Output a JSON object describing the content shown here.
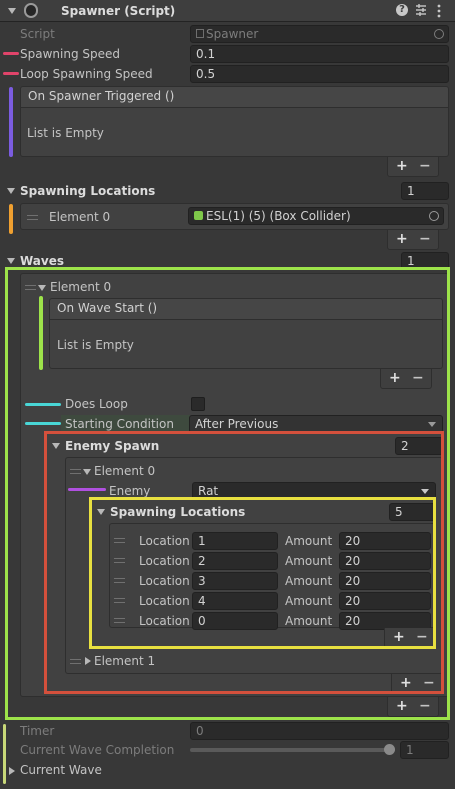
{
  "component": {
    "title": "Spawner (Script)",
    "icons": [
      "script-icon",
      "help-icon",
      "preset-icon",
      "more-menu-icon"
    ]
  },
  "fields": {
    "script_label": "Script",
    "script_value": "Spawner",
    "spawning_speed_label": "Spawning Speed",
    "spawning_speed_value": "0.1",
    "loop_speed_label": "Loop Spawning Speed",
    "loop_speed_value": "0.5"
  },
  "event_on_spawner_triggered": {
    "title": "On Spawner Triggered ()",
    "empty": "List is Empty"
  },
  "spawning_locations": {
    "label": "Spawning Locations",
    "count": "1",
    "element_label": "Element 0",
    "element_value": "ESL(1) (5) (Box Collider)"
  },
  "waves": {
    "label": "Waves",
    "count": "1",
    "element0": {
      "label": "Element 0",
      "on_wave_start": {
        "title": "On Wave Start ()",
        "empty": "List is Empty"
      },
      "does_loop_label": "Does Loop",
      "starting_condition_label": "Starting Condition",
      "starting_condition_value": "After Previous",
      "enemy_spawn": {
        "label": "Enemy Spawn",
        "count": "2",
        "element0_label": "Element 0",
        "enemy_label": "Enemy",
        "enemy_value": "Rat",
        "spawning_locations": {
          "label": "Spawning Locations",
          "count": "5",
          "location_label": "Location",
          "amount_label": "Amount",
          "rows": [
            {
              "location": "1",
              "amount": "20"
            },
            {
              "location": "2",
              "amount": "20"
            },
            {
              "location": "3",
              "amount": "20"
            },
            {
              "location": "4",
              "amount": "20"
            },
            {
              "location": "0",
              "amount": "20"
            }
          ]
        },
        "element1_label": "Element 1"
      }
    }
  },
  "timer": {
    "label": "Timer",
    "value": "0"
  },
  "completion": {
    "label": "Current Wave Completion",
    "value": "1",
    "fraction": 1.0
  },
  "current_wave": {
    "label": "Current Wave"
  },
  "buttons": {
    "plus": "+",
    "minus": "−"
  },
  "colors": {
    "pink": "#e0446a",
    "purple": "#7b5ce0",
    "orange": "#f0a030",
    "green": "#9de34a",
    "cyan": "#49d6d6",
    "red": "#d4503c",
    "violet": "#b050e0",
    "yellow": "#e8e040"
  }
}
